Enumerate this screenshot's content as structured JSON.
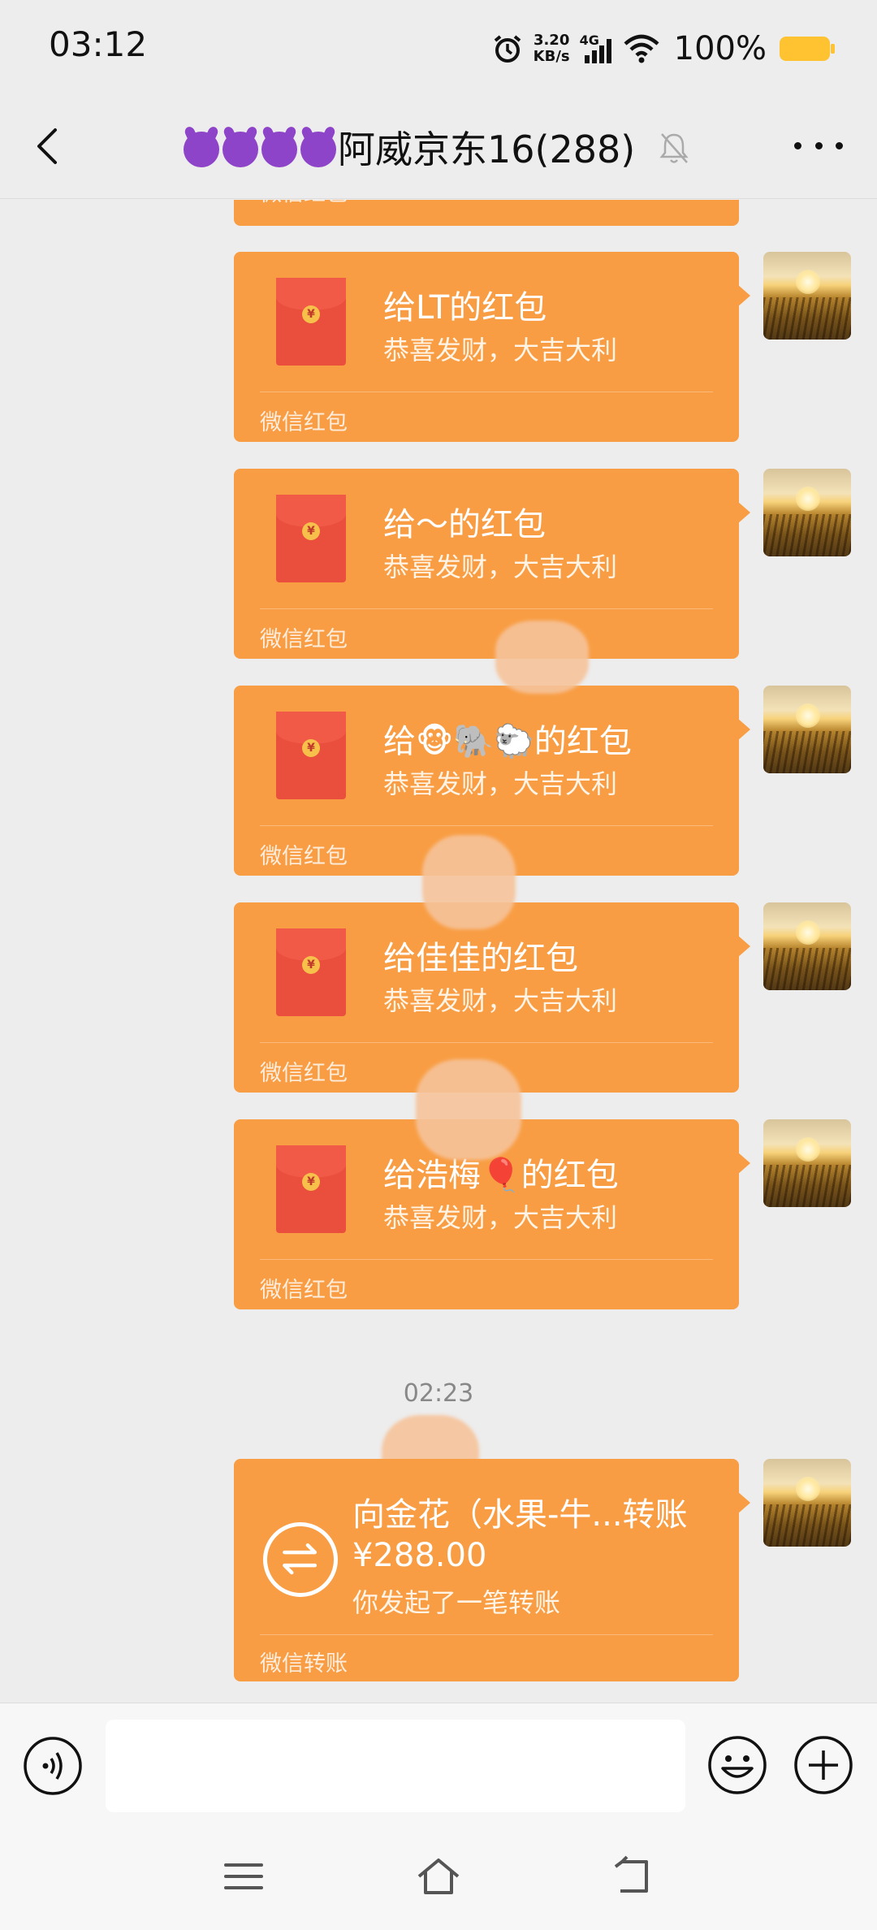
{
  "status_bar": {
    "time": "03:12",
    "speed_value": "3.20",
    "speed_unit": "KB/s",
    "network": "4G",
    "battery": "100%"
  },
  "header": {
    "title_emojis": [
      "smiling-devil",
      "smiling-devil",
      "smiling-devil",
      "smiling-devil"
    ],
    "title": "阿威京东16(288)",
    "back_icon": "chevron-left-icon",
    "mute_icon": "bell-muted-icon",
    "more_icon": "more-dots-icon"
  },
  "partial_bubble": {
    "footer": "微信红包"
  },
  "red_packets": [
    {
      "title": "给LT的红包",
      "subtitle": "恭喜发财，大吉大利",
      "footer": "微信红包"
    },
    {
      "title": "给～的红包",
      "subtitle": "恭喜发财，大吉大利",
      "footer": "微信红包"
    },
    {
      "title": "给🐵🐘🐑的红包",
      "subtitle": "恭喜发财，大吉大利",
      "footer": "微信红包"
    },
    {
      "title": "给佳佳的红包",
      "subtitle": "恭喜发财，大吉大利",
      "footer": "微信红包"
    },
    {
      "title": "给浩梅🎈的红包",
      "subtitle": "恭喜发财，大吉大利",
      "footer": "微信红包"
    }
  ],
  "timestamp": "02:23",
  "transfer": {
    "title": "向金花（水果-牛...转账",
    "amount": "¥288.00",
    "subtitle": "你发起了一笔转账",
    "footer": "微信转账"
  },
  "colors": {
    "bubble": "#f89d43",
    "background": "#ededed",
    "red_packet": "#ea4e3d"
  }
}
